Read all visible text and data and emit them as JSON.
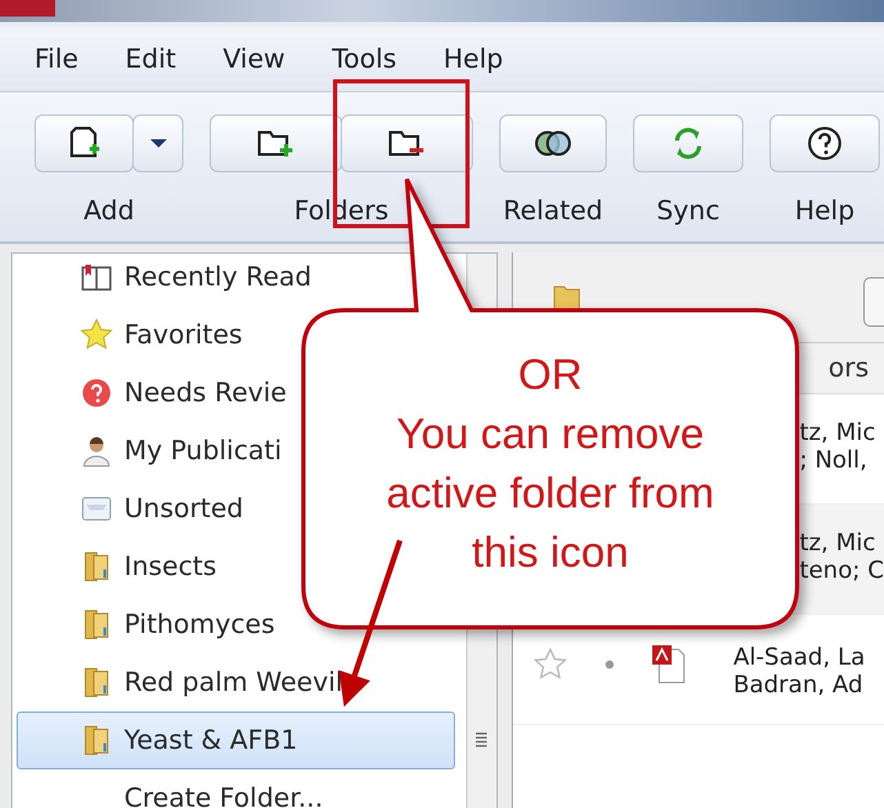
{
  "menu": [
    "File",
    "Edit",
    "View",
    "Tools",
    "Help"
  ],
  "toolbar": [
    {
      "label": "Add",
      "buttons": [
        {
          "kind": "add-document"
        },
        {
          "kind": "dropdown"
        }
      ]
    },
    {
      "label": "Folders",
      "buttons": [
        {
          "kind": "add-folder"
        },
        {
          "kind": "remove-folder"
        }
      ]
    },
    {
      "label": "Related",
      "buttons": [
        {
          "kind": "related"
        }
      ]
    },
    {
      "label": "Sync",
      "buttons": [
        {
          "kind": "sync"
        }
      ]
    },
    {
      "label": "Help",
      "buttons": [
        {
          "kind": "help"
        }
      ]
    }
  ],
  "sidebar": {
    "items": [
      {
        "label": "Recently Read",
        "kind": "book",
        "selected": false
      },
      {
        "label": "Favorites",
        "kind": "star",
        "selected": false
      },
      {
        "label": "Needs Revie",
        "kind": "question",
        "selected": false
      },
      {
        "label": "My Publicati",
        "kind": "person",
        "selected": false
      },
      {
        "label": "Unsorted",
        "kind": "tray",
        "selected": false
      },
      {
        "label": "Insects",
        "kind": "folder",
        "selected": false
      },
      {
        "label": "Pithomyces",
        "kind": "folder",
        "selected": false
      },
      {
        "label": "Red palm Weevil",
        "kind": "folder",
        "selected": false
      },
      {
        "label": "Yeast & AFB1",
        "kind": "folder",
        "selected": true
      },
      {
        "label": "Create Folder...",
        "kind": "action",
        "selected": false
      }
    ]
  },
  "content": {
    "column_heading": "ors",
    "rows": [
      {
        "kind": "covered",
        "lines": [
          "tz, Mic",
          "; Noll,"
        ]
      },
      {
        "kind": "covered",
        "lines": [
          "tz, Mic",
          "teno; C"
        ]
      },
      {
        "kind": "document",
        "lines": [
          "Al-Saad, La",
          "Badran, Ad"
        ]
      }
    ]
  },
  "callout": {
    "heading": "OR",
    "text": "You can remove active folder from this icon"
  }
}
